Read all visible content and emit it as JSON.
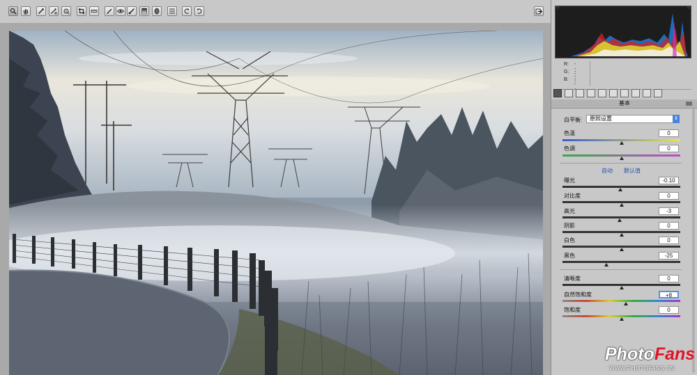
{
  "toolbar": {
    "tools": [
      {
        "name": "zoom",
        "icon": "magnifier-icon"
      },
      {
        "name": "hand",
        "icon": "hand-icon"
      },
      {
        "name": "white-balance",
        "icon": "eyedropper-icon"
      },
      {
        "name": "color-sampler",
        "icon": "color-sampler-icon"
      },
      {
        "name": "targeted-adjustment",
        "icon": "target-adjust-icon"
      },
      {
        "name": "crop",
        "icon": "crop-icon"
      },
      {
        "name": "straighten",
        "icon": "straighten-icon"
      },
      {
        "name": "spot-removal",
        "icon": "brush-icon"
      },
      {
        "name": "red-eye",
        "icon": "red-eye-icon"
      },
      {
        "name": "adjustment-brush",
        "icon": "adjustment-brush-icon"
      },
      {
        "name": "graduated-filter",
        "icon": "graduated-filter-icon"
      },
      {
        "name": "radial-filter",
        "icon": "radial-filter-icon"
      },
      {
        "name": "preferences",
        "icon": "list-icon"
      },
      {
        "name": "rotate-ccw",
        "icon": "rotate-ccw-icon"
      },
      {
        "name": "rotate-cw",
        "icon": "rotate-cw-icon"
      }
    ],
    "open_icon": "export-icon"
  },
  "rgb": {
    "r_label": "R:",
    "g_label": "G:",
    "b_label": "B:",
    "r": "---",
    "g": "---",
    "b": "---"
  },
  "panel": {
    "title": "基本"
  },
  "wb": {
    "label": "白平衡:",
    "value": "原照设置"
  },
  "sliders_top": [
    {
      "label": "色温",
      "value": "0",
      "level": 0.5
    },
    {
      "label": "色调",
      "value": "0",
      "level": 0.5
    }
  ],
  "links": {
    "auto": "自动",
    "default": "默认值"
  },
  "sliders_tone": [
    {
      "label": "曝光",
      "value": "-0.10",
      "level": 0.49
    },
    {
      "label": "对比度",
      "value": "0",
      "level": 0.5
    },
    {
      "label": "高光",
      "value": "-3",
      "level": 0.485
    },
    {
      "label": "阴影",
      "value": "0",
      "level": 0.5
    },
    {
      "label": "白色",
      "value": "0",
      "level": 0.5
    },
    {
      "label": "黑色",
      "value": "-25",
      "level": 0.375
    }
  ],
  "sliders_presence": [
    {
      "label": "清晰度",
      "value": "0",
      "level": 0.5
    },
    {
      "label": "自然饱和度",
      "value": "+8",
      "level": 0.54
    },
    {
      "label": "饱和度",
      "value": "0",
      "level": 0.5
    }
  ],
  "watermark": {
    "brand_a": "Photo",
    "brand_b": "Fans",
    "url": "WWW.PHOTOFANS.CN"
  }
}
